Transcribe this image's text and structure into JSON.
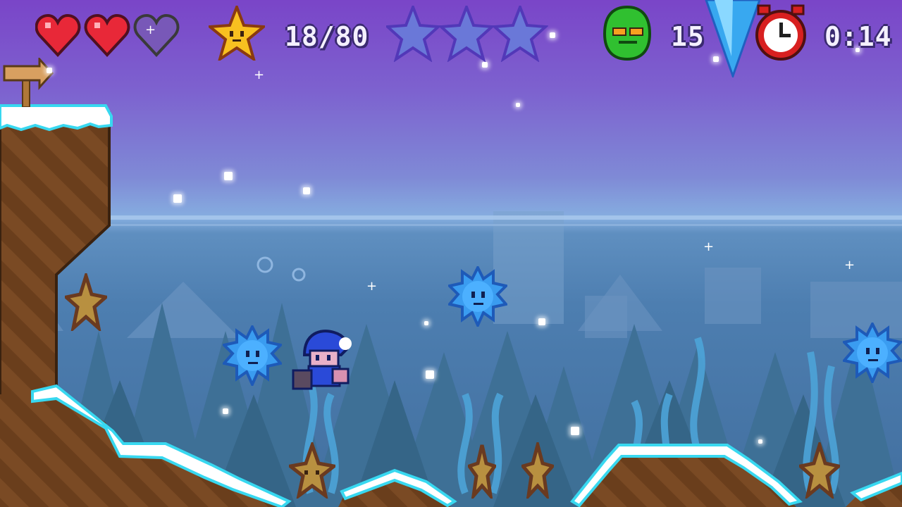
{
  "hud": {
    "hearts": {
      "total": 3,
      "filled": 2
    },
    "stars": {
      "count_text": "18/80"
    },
    "big_stars": {
      "total": 3,
      "collected": 0
    },
    "enemies": {
      "count_text": "15"
    },
    "timer": {
      "time_text": "0:14"
    }
  },
  "icons": {
    "heart": "heart-icon",
    "star": "star-icon",
    "enemy": "green-blob-icon",
    "clock": "alarm-clock-icon",
    "sign": "arrow-signpost"
  },
  "colors": {
    "sky_top": "#7a45c8",
    "water": "#4d7eb0",
    "snow": "#ffffff",
    "ice_edge": "#38d8f0",
    "dirt": "#7a4a24",
    "heart_red": "#e82838",
    "star_gold": "#f8c020",
    "enemy_green": "#30c030",
    "player_blue": "#2050d0"
  }
}
